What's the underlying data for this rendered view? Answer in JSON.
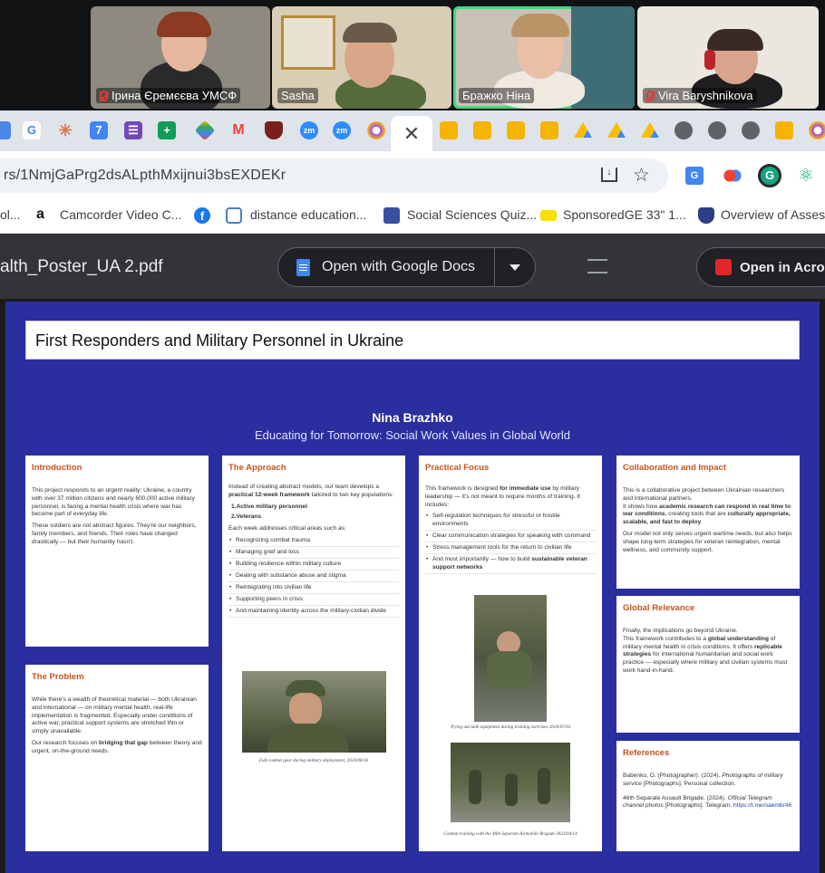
{
  "meeting": {
    "participants": [
      {
        "name": "Ірина Єремєєва УМСФ",
        "muted": true
      },
      {
        "name": "Sasha",
        "muted": false
      },
      {
        "name": "Бражко Ніна",
        "muted": false,
        "speaking": true
      },
      {
        "name": "Vira Baryshnikova",
        "muted": true
      }
    ]
  },
  "browser": {
    "tabs": [
      {
        "icon": "gmail-icon"
      },
      {
        "icon": "google-icon"
      },
      {
        "icon": "claude-icon"
      },
      {
        "icon": "calendar-icon"
      },
      {
        "icon": "forms-icon"
      },
      {
        "icon": "sheets-icon"
      },
      {
        "icon": "keep-icon"
      },
      {
        "icon": "gmail-icon"
      },
      {
        "icon": "shield-icon"
      },
      {
        "icon": "zoom-icon",
        "label": "zm"
      },
      {
        "icon": "zoom-icon",
        "label": "zm"
      },
      {
        "icon": "extension-icon"
      }
    ],
    "active_tab_icon": "close-icon",
    "url": "rs/1NmjGaPrg2dsALpthMxijnui3bsEXDEKr",
    "bookmarks": [
      {
        "label": "ol..."
      },
      {
        "label": "Camcorder Video C..."
      },
      {
        "label": ""
      },
      {
        "label": "distance education..."
      },
      {
        "label": "Social Sciences Quiz..."
      },
      {
        "label": "SponsoredGE 33\" 1..."
      },
      {
        "label": "Overview of Assess..."
      }
    ]
  },
  "pdf_viewer": {
    "file_name": "alth_Poster_UA 2.pdf",
    "open_google_docs": "Open with Google Docs",
    "open_acrobat": "Open in Acroba"
  },
  "poster": {
    "title": "First Responders and Military Personnel in Ukraine",
    "author": "Nina Brazhko",
    "subtitle": "Educating for Tomorrow: Social Work Values in Global World",
    "introduction": {
      "heading": "Introduction",
      "p1": "This project responds to an urgent reality: Ukraine, a country with over 37 million citizens and nearly 600,000 active military personnel, is facing a mental health crisis where war has become part of everyday life.",
      "p2": "These soldiers are not abstract figures. They're our neighbors, family members, and friends. Their roles have changed drastically — but their humanity hasn't."
    },
    "problem": {
      "heading": "The Problem",
      "p1": "While there's a wealth of theoretical material — both Ukrainian and international — on military mental health, real-life implementation is fragmented. Especially under conditions of active war, practical support systems are stretched thin or simply unavailable.",
      "p2_pre": "Our research focuses on",
      "p2_bold": "bridging that gap",
      "p2_post": "between theory and urgent, on-the-ground needs."
    },
    "approach": {
      "heading": "The Approach",
      "intro_pre": "Instead of creating abstract models, our team develops a",
      "intro_bold": "practical 12-week framework",
      "intro_post": "tailored to two key populations:",
      "populations": [
        "1.Active military personnel",
        "2.Veterans"
      ],
      "week_intro": "Each week addresses critical areas such as:",
      "items": [
        "Recognizing combat trauma",
        "Managing grief and loss",
        "Building resilience within military culture",
        "Dealing with substance abuse and stigma",
        "Reintegrating into civilian life",
        "Supporting peers in crisis",
        "And maintaining identity across the military-civilian divide"
      ],
      "caption": "Full combat gear during military deployment, 2024/06/16"
    },
    "focus": {
      "heading": "Practical Focus",
      "intro_pre": "This framework is designed",
      "intro_bold": "for immediate use",
      "intro_post": "by military leadership — it's not meant to require months of training. It includes:",
      "items": [
        "Self-regulation techniques for stressful or hostile environments",
        "Clear communication strategies for speaking with command",
        "Stress management tools for the return to civilian life"
      ],
      "last_pre": "And most importantly — how to build",
      "last_bold": "sustainable veteran support networks",
      "caption1": "Trying out tank equipment during training exercises 2024/07/03",
      "caption2": "Combat training with the 46th Separate Airmobile Brigade 2023/04/14"
    },
    "collaboration": {
      "heading": "Collaboration and Impact",
      "p1": "This is a collaborative project between Ukrainian researchers and international partners.",
      "p2_pre": "It shows how",
      "p2_bold1": "academic research can respond in real time to war conditions",
      "p2_mid": ", creating tools that are",
      "p2_bold2": "culturally appropriate, scalable, and fast to deploy",
      "p2_post": ".",
      "p3": "Our model not only serves urgent wartime needs, but also helps shape long-term strategies for veteran reintegration, mental wellness, and community support."
    },
    "global": {
      "heading": "Global Relevance",
      "p1": "Finally, the implications go beyond Ukraine.",
      "p2_pre": "This framework contributes to a",
      "p2_bold1": "global understanding",
      "p2_mid": "of military mental health in crisis conditions. It offers",
      "p2_bold2": "replicable strategies",
      "p2_post": "for international humanitarian and social work practice — especially where military and civilian systems must work hand-in-hand."
    },
    "references": {
      "heading": "References",
      "r1_pre": "Babenko, O. (Photographer). (2024).",
      "r1_ital": "Photographs of military service",
      "r1_post": "[Photographs]. Personal collection.",
      "r2_pre": "46th Separate Assault Brigade. (2024).",
      "r2_ital": "Official Telegram channel photos",
      "r2_post": "[Photographs]. Telegram.",
      "r2_link": "https://t.me/oaembr46"
    }
  },
  "colors": {
    "poster_bg": "#2b2e9e",
    "heading": "#c6531d",
    "speaker_border": "#3ddc84",
    "muted_icon": "#e53935"
  }
}
